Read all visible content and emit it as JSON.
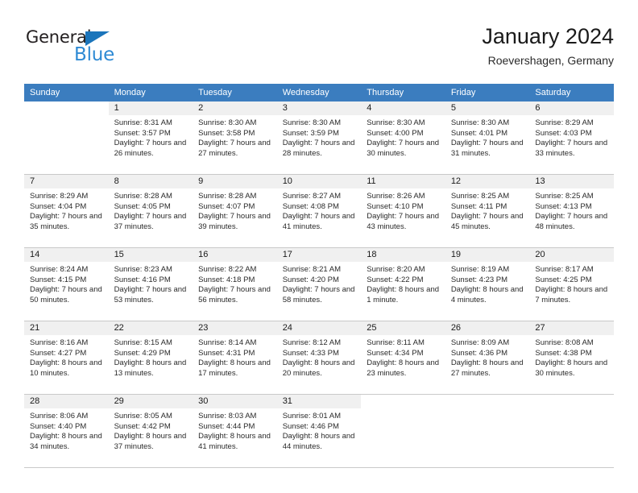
{
  "brand": {
    "word_one": "General",
    "word_two": "Blue",
    "triangle_icon": "triangle-icon",
    "accent_color": "#1b75bb",
    "secondary_color": "#2e8ad4"
  },
  "header": {
    "title": "January 2024",
    "subtitle": "Roevershagen, Germany"
  },
  "theme": {
    "header_row_bg": "#3b7dbf",
    "daynum_bg": "#f0f0f0",
    "grid_line": "#c9c9c9"
  },
  "weekdays": [
    "Sunday",
    "Monday",
    "Tuesday",
    "Wednesday",
    "Thursday",
    "Friday",
    "Saturday"
  ],
  "weeks": [
    [
      {
        "day": "",
        "sunrise": "",
        "sunset": "",
        "daylight": "",
        "blank": true,
        "leading_shaded": true
      },
      {
        "day": "1",
        "sunrise": "Sunrise: 8:31 AM",
        "sunset": "Sunset: 3:57 PM",
        "daylight": "Daylight: 7 hours and 26 minutes."
      },
      {
        "day": "2",
        "sunrise": "Sunrise: 8:30 AM",
        "sunset": "Sunset: 3:58 PM",
        "daylight": "Daylight: 7 hours and 27 minutes."
      },
      {
        "day": "3",
        "sunrise": "Sunrise: 8:30 AM",
        "sunset": "Sunset: 3:59 PM",
        "daylight": "Daylight: 7 hours and 28 minutes."
      },
      {
        "day": "4",
        "sunrise": "Sunrise: 8:30 AM",
        "sunset": "Sunset: 4:00 PM",
        "daylight": "Daylight: 7 hours and 30 minutes."
      },
      {
        "day": "5",
        "sunrise": "Sunrise: 8:30 AM",
        "sunset": "Sunset: 4:01 PM",
        "daylight": "Daylight: 7 hours and 31 minutes."
      },
      {
        "day": "6",
        "sunrise": "Sunrise: 8:29 AM",
        "sunset": "Sunset: 4:03 PM",
        "daylight": "Daylight: 7 hours and 33 minutes."
      }
    ],
    [
      {
        "day": "7",
        "sunrise": "Sunrise: 8:29 AM",
        "sunset": "Sunset: 4:04 PM",
        "daylight": "Daylight: 7 hours and 35 minutes."
      },
      {
        "day": "8",
        "sunrise": "Sunrise: 8:28 AM",
        "sunset": "Sunset: 4:05 PM",
        "daylight": "Daylight: 7 hours and 37 minutes."
      },
      {
        "day": "9",
        "sunrise": "Sunrise: 8:28 AM",
        "sunset": "Sunset: 4:07 PM",
        "daylight": "Daylight: 7 hours and 39 minutes."
      },
      {
        "day": "10",
        "sunrise": "Sunrise: 8:27 AM",
        "sunset": "Sunset: 4:08 PM",
        "daylight": "Daylight: 7 hours and 41 minutes."
      },
      {
        "day": "11",
        "sunrise": "Sunrise: 8:26 AM",
        "sunset": "Sunset: 4:10 PM",
        "daylight": "Daylight: 7 hours and 43 minutes."
      },
      {
        "day": "12",
        "sunrise": "Sunrise: 8:25 AM",
        "sunset": "Sunset: 4:11 PM",
        "daylight": "Daylight: 7 hours and 45 minutes."
      },
      {
        "day": "13",
        "sunrise": "Sunrise: 8:25 AM",
        "sunset": "Sunset: 4:13 PM",
        "daylight": "Daylight: 7 hours and 48 minutes."
      }
    ],
    [
      {
        "day": "14",
        "sunrise": "Sunrise: 8:24 AM",
        "sunset": "Sunset: 4:15 PM",
        "daylight": "Daylight: 7 hours and 50 minutes."
      },
      {
        "day": "15",
        "sunrise": "Sunrise: 8:23 AM",
        "sunset": "Sunset: 4:16 PM",
        "daylight": "Daylight: 7 hours and 53 minutes."
      },
      {
        "day": "16",
        "sunrise": "Sunrise: 8:22 AM",
        "sunset": "Sunset: 4:18 PM",
        "daylight": "Daylight: 7 hours and 56 minutes."
      },
      {
        "day": "17",
        "sunrise": "Sunrise: 8:21 AM",
        "sunset": "Sunset: 4:20 PM",
        "daylight": "Daylight: 7 hours and 58 minutes."
      },
      {
        "day": "18",
        "sunrise": "Sunrise: 8:20 AM",
        "sunset": "Sunset: 4:22 PM",
        "daylight": "Daylight: 8 hours and 1 minute."
      },
      {
        "day": "19",
        "sunrise": "Sunrise: 8:19 AM",
        "sunset": "Sunset: 4:23 PM",
        "daylight": "Daylight: 8 hours and 4 minutes."
      },
      {
        "day": "20",
        "sunrise": "Sunrise: 8:17 AM",
        "sunset": "Sunset: 4:25 PM",
        "daylight": "Daylight: 8 hours and 7 minutes."
      }
    ],
    [
      {
        "day": "21",
        "sunrise": "Sunrise: 8:16 AM",
        "sunset": "Sunset: 4:27 PM",
        "daylight": "Daylight: 8 hours and 10 minutes."
      },
      {
        "day": "22",
        "sunrise": "Sunrise: 8:15 AM",
        "sunset": "Sunset: 4:29 PM",
        "daylight": "Daylight: 8 hours and 13 minutes."
      },
      {
        "day": "23",
        "sunrise": "Sunrise: 8:14 AM",
        "sunset": "Sunset: 4:31 PM",
        "daylight": "Daylight: 8 hours and 17 minutes."
      },
      {
        "day": "24",
        "sunrise": "Sunrise: 8:12 AM",
        "sunset": "Sunset: 4:33 PM",
        "daylight": "Daylight: 8 hours and 20 minutes."
      },
      {
        "day": "25",
        "sunrise": "Sunrise: 8:11 AM",
        "sunset": "Sunset: 4:34 PM",
        "daylight": "Daylight: 8 hours and 23 minutes."
      },
      {
        "day": "26",
        "sunrise": "Sunrise: 8:09 AM",
        "sunset": "Sunset: 4:36 PM",
        "daylight": "Daylight: 8 hours and 27 minutes."
      },
      {
        "day": "27",
        "sunrise": "Sunrise: 8:08 AM",
        "sunset": "Sunset: 4:38 PM",
        "daylight": "Daylight: 8 hours and 30 minutes."
      }
    ],
    [
      {
        "day": "28",
        "sunrise": "Sunrise: 8:06 AM",
        "sunset": "Sunset: 4:40 PM",
        "daylight": "Daylight: 8 hours and 34 minutes."
      },
      {
        "day": "29",
        "sunrise": "Sunrise: 8:05 AM",
        "sunset": "Sunset: 4:42 PM",
        "daylight": "Daylight: 8 hours and 37 minutes."
      },
      {
        "day": "30",
        "sunrise": "Sunrise: 8:03 AM",
        "sunset": "Sunset: 4:44 PM",
        "daylight": "Daylight: 8 hours and 41 minutes."
      },
      {
        "day": "31",
        "sunrise": "Sunrise: 8:01 AM",
        "sunset": "Sunset: 4:46 PM",
        "daylight": "Daylight: 8 hours and 44 minutes."
      },
      {
        "day": "",
        "sunrise": "",
        "sunset": "",
        "daylight": "",
        "blank": true
      },
      {
        "day": "",
        "sunrise": "",
        "sunset": "",
        "daylight": "",
        "blank": true
      },
      {
        "day": "",
        "sunrise": "",
        "sunset": "",
        "daylight": "",
        "blank": true
      }
    ]
  ]
}
